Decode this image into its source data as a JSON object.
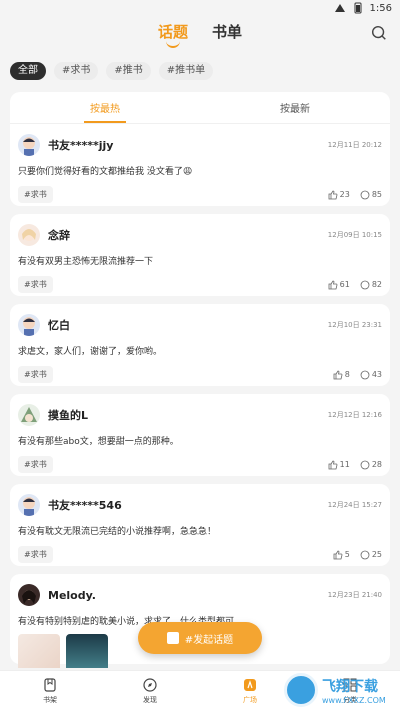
{
  "status": {
    "time": "1:56"
  },
  "topnav": {
    "tabs": [
      {
        "label": "话题",
        "active": true
      },
      {
        "label": "书单",
        "active": false
      }
    ]
  },
  "chips": [
    {
      "label": "全部",
      "active": true
    },
    {
      "label": "#求书"
    },
    {
      "label": "#推书"
    },
    {
      "label": "#推书单"
    }
  ],
  "sort": {
    "hot": "按最热",
    "new": "按最新"
  },
  "posts": [
    {
      "user": "书友*****jjy",
      "date": "12月11日 20:12",
      "content": "只要你们觉得好看的文都推给我 没文看了😩",
      "tag": "#求书",
      "likes": "23",
      "comments": "85"
    },
    {
      "user": "念辞",
      "date": "12月09日 10:15",
      "content": "有没有双男主恐怖无限流推荐一下",
      "tag": "#求书",
      "likes": "61",
      "comments": "82"
    },
    {
      "user": "忆白",
      "date": "12月10日 23:31",
      "content": "求虐文，家人们，谢谢了，爱你哟。",
      "tag": "#求书",
      "likes": "8",
      "comments": "43"
    },
    {
      "user": "摸鱼的L",
      "date": "12月12日 12:16",
      "content": "有没有那些abo文，想要甜一点的那种。",
      "tag": "#求书",
      "likes": "11",
      "comments": "28"
    },
    {
      "user": "书友*****546",
      "date": "12月24日 15:27",
      "content": "有没有耽文无限流已完结的小说推荐啊，急急急！",
      "tag": "#求书",
      "likes": "5",
      "comments": "25"
    },
    {
      "user": "Melody.",
      "date": "12月23日 21:40",
      "content": "有没有特别特别虐的耽美小说，求求了，什么类型都可"
    }
  ],
  "fab": {
    "label": "#发起话题"
  },
  "bottomnav": [
    {
      "label": "书架"
    },
    {
      "label": "发现"
    },
    {
      "label": "广场",
      "active": true
    },
    {
      "label": "分类"
    }
  ],
  "watermark": {
    "cn": "飞翔下载",
    "url": "www.FXXZ.COM"
  },
  "colors": {
    "accent": "#f29a1d",
    "fab": "#f4a531"
  }
}
